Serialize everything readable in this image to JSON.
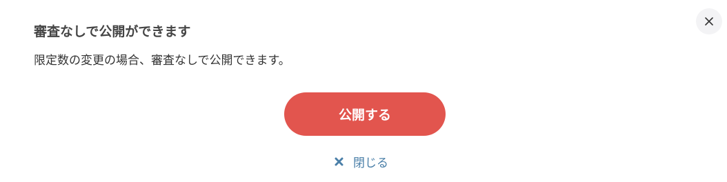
{
  "dialog": {
    "title": "審査なしで公開ができます",
    "message": "限定数の変更の場合、審査なしで公開できます。",
    "publish_label": "公開する",
    "close_label": "閉じる",
    "close_icon": "close-icon"
  },
  "colors": {
    "primary_button": "#e2554e",
    "link": "#4a7fa8",
    "close_circle": "#f3f3f5"
  }
}
